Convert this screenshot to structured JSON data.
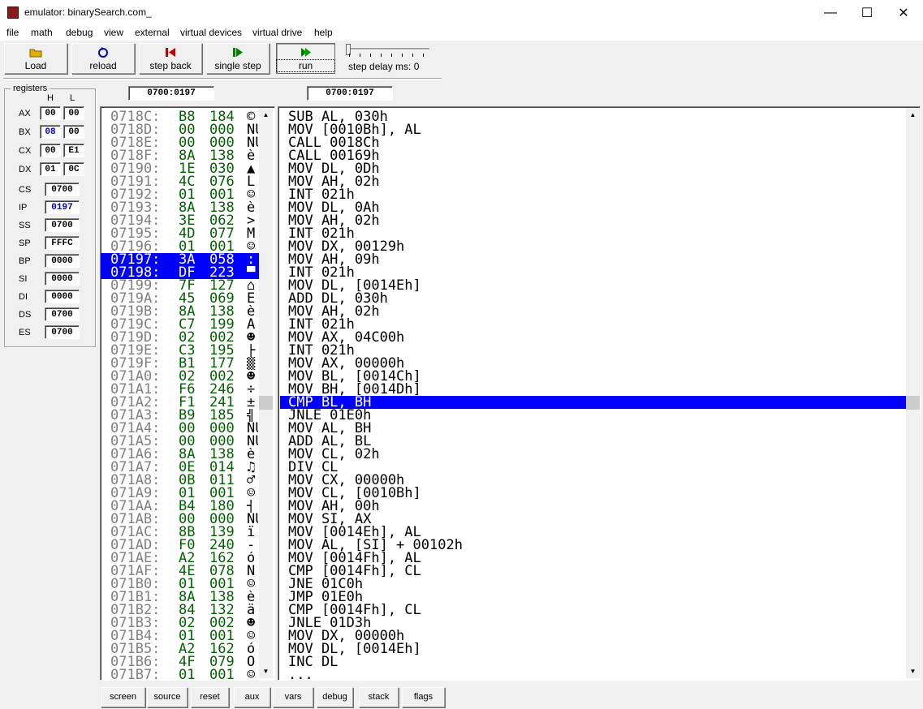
{
  "window": {
    "title": "emulator: binarySearch.com_",
    "minimize": "—",
    "maximize": "☐",
    "close": "✕"
  },
  "menu": [
    "file",
    "math",
    "debug",
    "view",
    "external",
    "virtual devices",
    "virtual drive",
    "help"
  ],
  "toolbar": {
    "load": "Load",
    "reload": "reload",
    "step_back": "step back",
    "single_step": "single step",
    "run": "run",
    "step_delay_label": "step delay ms: 0",
    "colors": {
      "load": "#c8a000",
      "reload": "#0000c0",
      "step_back": "#c00000",
      "single_step": "#008000",
      "run": "#008000"
    }
  },
  "registers": {
    "legend": "registers",
    "h_label": "H",
    "l_label": "L",
    "pairs": [
      {
        "name": "AX",
        "h": "00",
        "l": "00",
        "h_color": "#000000"
      },
      {
        "name": "BX",
        "h": "08",
        "l": "00",
        "h_color": "#0000c0"
      },
      {
        "name": "CX",
        "h": "00",
        "l": "E1",
        "h_color": "#000000"
      },
      {
        "name": "DX",
        "h": "01",
        "l": "0C",
        "h_color": "#000000"
      }
    ],
    "singles": [
      {
        "name": "CS",
        "value": "0700",
        "color": "#000000"
      },
      {
        "name": "IP",
        "value": "0197",
        "color": "#0000c0"
      },
      {
        "name": "SS",
        "value": "0700",
        "color": "#000000"
      },
      {
        "name": "SP",
        "value": "FFFC",
        "color": "#000000"
      },
      {
        "name": "BP",
        "value": "0000",
        "color": "#000000"
      },
      {
        "name": "SI",
        "value": "0000",
        "color": "#000000"
      },
      {
        "name": "DI",
        "value": "0000",
        "color": "#000000"
      },
      {
        "name": "DS",
        "value": "0700",
        "color": "#000000"
      },
      {
        "name": "ES",
        "value": "0700",
        "color": "#000000"
      }
    ]
  },
  "address_left": "0700:0197",
  "address_right": "0700:0197",
  "memory": [
    {
      "addr": "0718C:",
      "hex": "B8",
      "dec": "184",
      "chr": "©"
    },
    {
      "addr": "0718D:",
      "hex": "00",
      "dec": "000",
      "chr": "NU"
    },
    {
      "addr": "0718E:",
      "hex": "00",
      "dec": "000",
      "chr": "NU"
    },
    {
      "addr": "0718F:",
      "hex": "8A",
      "dec": "138",
      "chr": "è"
    },
    {
      "addr": "07190:",
      "hex": "1E",
      "dec": "030",
      "chr": "▲"
    },
    {
      "addr": "07191:",
      "hex": "4C",
      "dec": "076",
      "chr": "L"
    },
    {
      "addr": "07192:",
      "hex": "01",
      "dec": "001",
      "chr": "☺"
    },
    {
      "addr": "07193:",
      "hex": "8A",
      "dec": "138",
      "chr": "è"
    },
    {
      "addr": "07194:",
      "hex": "3E",
      "dec": "062",
      "chr": ">"
    },
    {
      "addr": "07195:",
      "hex": "4D",
      "dec": "077",
      "chr": "M"
    },
    {
      "addr": "07196:",
      "hex": "01",
      "dec": "001",
      "chr": "☺"
    },
    {
      "addr": "07197:",
      "hex": "3A",
      "dec": "058",
      "chr": ":",
      "sel": true
    },
    {
      "addr": "07198:",
      "hex": "DF",
      "dec": "223",
      "chr": "▀",
      "sel": true
    },
    {
      "addr": "07199:",
      "hex": "7F",
      "dec": "127",
      "chr": "⌂"
    },
    {
      "addr": "0719A:",
      "hex": "45",
      "dec": "069",
      "chr": "E"
    },
    {
      "addr": "0719B:",
      "hex": "8A",
      "dec": "138",
      "chr": "è"
    },
    {
      "addr": "0719C:",
      "hex": "C7",
      "dec": "199",
      "chr": "Ã"
    },
    {
      "addr": "0719D:",
      "hex": "02",
      "dec": "002",
      "chr": "☻"
    },
    {
      "addr": "0719E:",
      "hex": "C3",
      "dec": "195",
      "chr": "├"
    },
    {
      "addr": "0719F:",
      "hex": "B1",
      "dec": "177",
      "chr": "▒"
    },
    {
      "addr": "071A0:",
      "hex": "02",
      "dec": "002",
      "chr": "☻"
    },
    {
      "addr": "071A1:",
      "hex": "F6",
      "dec": "246",
      "chr": "÷"
    },
    {
      "addr": "071A2:",
      "hex": "F1",
      "dec": "241",
      "chr": "±"
    },
    {
      "addr": "071A3:",
      "hex": "B9",
      "dec": "185",
      "chr": "╣"
    },
    {
      "addr": "071A4:",
      "hex": "00",
      "dec": "000",
      "chr": "NU"
    },
    {
      "addr": "071A5:",
      "hex": "00",
      "dec": "000",
      "chr": "NU"
    },
    {
      "addr": "071A6:",
      "hex": "8A",
      "dec": "138",
      "chr": "è"
    },
    {
      "addr": "071A7:",
      "hex": "0E",
      "dec": "014",
      "chr": "♫"
    },
    {
      "addr": "071A8:",
      "hex": "0B",
      "dec": "011",
      "chr": "♂"
    },
    {
      "addr": "071A9:",
      "hex": "01",
      "dec": "001",
      "chr": "☺"
    },
    {
      "addr": "071AA:",
      "hex": "B4",
      "dec": "180",
      "chr": "┤"
    },
    {
      "addr": "071AB:",
      "hex": "00",
      "dec": "000",
      "chr": "NU"
    },
    {
      "addr": "071AC:",
      "hex": "8B",
      "dec": "139",
      "chr": "ï"
    },
    {
      "addr": "071AD:",
      "hex": "F0",
      "dec": "240",
      "chr": "-"
    },
    {
      "addr": "071AE:",
      "hex": "A2",
      "dec": "162",
      "chr": "ó"
    },
    {
      "addr": "071AF:",
      "hex": "4E",
      "dec": "078",
      "chr": "N"
    },
    {
      "addr": "071B0:",
      "hex": "01",
      "dec": "001",
      "chr": "☺"
    },
    {
      "addr": "071B1:",
      "hex": "8A",
      "dec": "138",
      "chr": "è"
    },
    {
      "addr": "071B2:",
      "hex": "84",
      "dec": "132",
      "chr": "ä"
    },
    {
      "addr": "071B3:",
      "hex": "02",
      "dec": "002",
      "chr": "☻"
    },
    {
      "addr": "071B4:",
      "hex": "01",
      "dec": "001",
      "chr": "☺"
    },
    {
      "addr": "071B5:",
      "hex": "A2",
      "dec": "162",
      "chr": "ó"
    },
    {
      "addr": "071B6:",
      "hex": "4F",
      "dec": "079",
      "chr": "O"
    },
    {
      "addr": "071B7:",
      "hex": "01",
      "dec": "001",
      "chr": "☺"
    }
  ],
  "disasm": [
    "SUB AL, 030h",
    "MOV [0010Bh], AL",
    "CALL 0018Ch",
    "CALL 00169h",
    "MOV DL, 0Dh",
    "MOV AH, 02h",
    "INT 021h",
    "MOV DL, 0Ah",
    "MOV AH, 02h",
    "INT 021h",
    "MOV DX, 00129h",
    "MOV AH, 09h",
    "INT 021h",
    "MOV DL, [0014Eh]",
    "ADD DL, 030h",
    "MOV AH, 02h",
    "INT 021h",
    "MOV AX, 04C00h",
    "INT 021h",
    "MOV AX, 00000h",
    "MOV BL, [0014Ch]",
    "MOV BH, [0014Dh]",
    "CMP BL, BH",
    "JNLE 01E0h",
    "MOV AL, BH",
    "ADD AL, BL",
    "MOV CL, 02h",
    "DIV CL",
    "MOV CX, 00000h",
    "MOV CL, [0010Bh]",
    "MOV AH, 00h",
    "MOV SI, AX",
    "MOV [0014Eh], AL",
    "MOV AL, [SI] + 00102h",
    "MOV [0014Fh], AL",
    "CMP [0014Fh], CL",
    "JNE 01C0h",
    "JMP 01E0h",
    "CMP [0014Fh], CL",
    "JNLE 01D3h",
    "MOV DX, 00000h",
    "MOV DL, [0014Eh]",
    "INC DL",
    "..."
  ],
  "disasm_selected_index": 22,
  "bottom_buttons": [
    "screen",
    "source",
    "reset",
    "aux",
    "vars",
    "debug",
    "stack",
    "flags"
  ]
}
